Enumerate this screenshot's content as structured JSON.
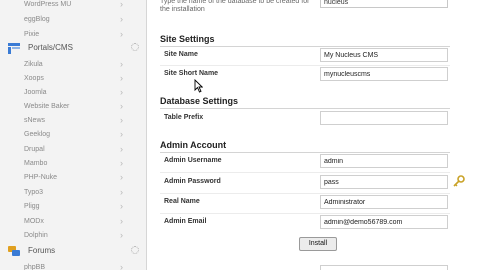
{
  "sidebar": {
    "items": [
      {
        "label": "WordPress MU"
      },
      {
        "label": "eggBlog"
      },
      {
        "label": "Pixie"
      },
      {
        "category": "Portals/CMS"
      },
      {
        "label": "Zikula"
      },
      {
        "label": "Xoops"
      },
      {
        "label": "Joomla"
      },
      {
        "label": "Website Baker"
      },
      {
        "label": "sNews"
      },
      {
        "label": "Geeklog"
      },
      {
        "label": "Drupal"
      },
      {
        "label": "Mambo"
      },
      {
        "label": "PHP-Nuke"
      },
      {
        "label": "Typo3"
      },
      {
        "label": "Pligg"
      },
      {
        "label": "MODx"
      },
      {
        "label": "Dolphin"
      },
      {
        "category": "Forums"
      },
      {
        "label": "phpBB"
      }
    ],
    "chevron": "›"
  },
  "install_form": {
    "db_note": "Type the name of the database to be created for the installation",
    "db_name_value": "nucleus",
    "site_settings": {
      "title": "Site Settings",
      "site_name_label": "Site Name",
      "site_name_value": "My Nucleus CMS",
      "short_name_label": "Site Short Name",
      "short_name_value": "mynucleuscms"
    },
    "database_settings": {
      "title": "Database Settings",
      "prefix_label": "Table Prefix",
      "prefix_value": ""
    },
    "admin_account": {
      "title": "Admin Account",
      "username_label": "Admin Username",
      "username_value": "admin",
      "password_label": "Admin Password",
      "password_value": "pass",
      "realname_label": "Real Name",
      "realname_value": "Administrator",
      "email_label": "Admin Email",
      "email_value": "admin@demo56789.com"
    },
    "install_label": "Install"
  },
  "colors": {
    "portals_icon": "#3a7bd5",
    "forums_icon": "#e0a020",
    "key_icon": "#c9a227"
  }
}
